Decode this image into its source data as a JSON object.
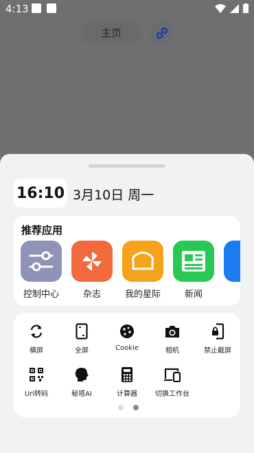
{
  "status_bar": {
    "time": "4:13"
  },
  "background": {
    "home_label": "主页",
    "link_icon": "link-icon"
  },
  "sheet": {
    "clock": "16:10",
    "date": "3月10日 周一",
    "recommended": {
      "title": "推荐应用",
      "apps": [
        {
          "label": "控制中心",
          "icon": "sliders-icon",
          "color": "#8f93b7"
        },
        {
          "label": "杂志",
          "icon": "pinwheel-icon",
          "color": "#f26a3d"
        },
        {
          "label": "我的星际",
          "icon": "bread-icon",
          "color": "#f7a21b"
        },
        {
          "label": "新闻",
          "icon": "news-icon",
          "color": "#27c954"
        }
      ]
    },
    "tools": [
      {
        "label": "横屏",
        "icon": "rotate-icon"
      },
      {
        "label": "全屏",
        "icon": "fullscreen-phone-icon"
      },
      {
        "label": "Cookie",
        "icon": "cookie-icon"
      },
      {
        "label": "相机",
        "icon": "camera-icon"
      },
      {
        "label": "禁止截屏",
        "icon": "lock-phone-icon"
      },
      {
        "label": "Url转码",
        "icon": "qr-code-icon"
      },
      {
        "label": "秘塔AI",
        "icon": "ai-head-icon"
      },
      {
        "label": "计算器",
        "icon": "calculator-icon"
      },
      {
        "label": "切换工作台",
        "icon": "devices-icon"
      }
    ],
    "page_indicator": {
      "pages": 2,
      "active": 2
    }
  }
}
